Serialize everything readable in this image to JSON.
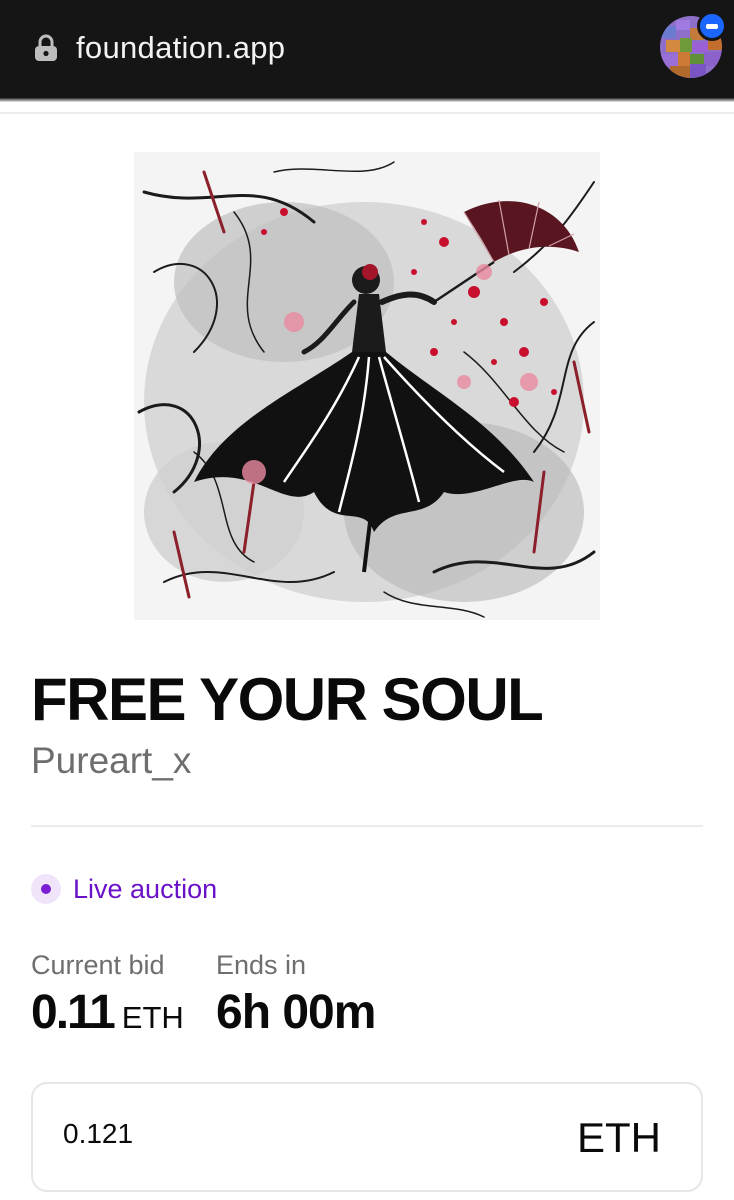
{
  "browser": {
    "url": "foundation.app",
    "lock_icon": "lock-icon",
    "avatar_icon": "user-avatar"
  },
  "artwork": {
    "title": "FREE YOUR SOUL",
    "artist": "Pureart_x",
    "image_icon": "artwork-image"
  },
  "auction": {
    "status": "Live auction",
    "current_bid_label": "Current bid",
    "current_bid_amount": "0.11",
    "current_bid_unit": "ETH",
    "ends_in_label": "Ends in",
    "ends_in_value": "6h 00m"
  },
  "bid_input": {
    "value": "0.121",
    "unit": "ETH"
  },
  "colors": {
    "browser_bar": "#151515",
    "accent_purple": "#6a12c7",
    "text_primary": "#0a0a0a",
    "text_secondary": "#6e6e6e"
  }
}
